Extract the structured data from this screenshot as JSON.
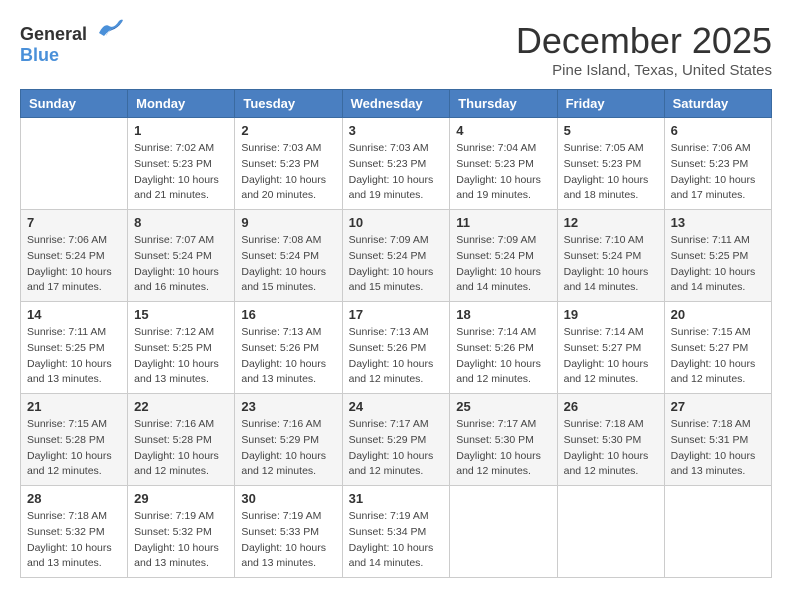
{
  "logo": {
    "text_general": "General",
    "text_blue": "Blue"
  },
  "title": "December 2025",
  "location": "Pine Island, Texas, United States",
  "headers": [
    "Sunday",
    "Monday",
    "Tuesday",
    "Wednesday",
    "Thursday",
    "Friday",
    "Saturday"
  ],
  "weeks": [
    [
      {
        "day": "",
        "info": ""
      },
      {
        "day": "1",
        "info": "Sunrise: 7:02 AM\nSunset: 5:23 PM\nDaylight: 10 hours\nand 21 minutes."
      },
      {
        "day": "2",
        "info": "Sunrise: 7:03 AM\nSunset: 5:23 PM\nDaylight: 10 hours\nand 20 minutes."
      },
      {
        "day": "3",
        "info": "Sunrise: 7:03 AM\nSunset: 5:23 PM\nDaylight: 10 hours\nand 19 minutes."
      },
      {
        "day": "4",
        "info": "Sunrise: 7:04 AM\nSunset: 5:23 PM\nDaylight: 10 hours\nand 19 minutes."
      },
      {
        "day": "5",
        "info": "Sunrise: 7:05 AM\nSunset: 5:23 PM\nDaylight: 10 hours\nand 18 minutes."
      },
      {
        "day": "6",
        "info": "Sunrise: 7:06 AM\nSunset: 5:23 PM\nDaylight: 10 hours\nand 17 minutes."
      }
    ],
    [
      {
        "day": "7",
        "info": "Sunrise: 7:06 AM\nSunset: 5:24 PM\nDaylight: 10 hours\nand 17 minutes."
      },
      {
        "day": "8",
        "info": "Sunrise: 7:07 AM\nSunset: 5:24 PM\nDaylight: 10 hours\nand 16 minutes."
      },
      {
        "day": "9",
        "info": "Sunrise: 7:08 AM\nSunset: 5:24 PM\nDaylight: 10 hours\nand 15 minutes."
      },
      {
        "day": "10",
        "info": "Sunrise: 7:09 AM\nSunset: 5:24 PM\nDaylight: 10 hours\nand 15 minutes."
      },
      {
        "day": "11",
        "info": "Sunrise: 7:09 AM\nSunset: 5:24 PM\nDaylight: 10 hours\nand 14 minutes."
      },
      {
        "day": "12",
        "info": "Sunrise: 7:10 AM\nSunset: 5:24 PM\nDaylight: 10 hours\nand 14 minutes."
      },
      {
        "day": "13",
        "info": "Sunrise: 7:11 AM\nSunset: 5:25 PM\nDaylight: 10 hours\nand 14 minutes."
      }
    ],
    [
      {
        "day": "14",
        "info": "Sunrise: 7:11 AM\nSunset: 5:25 PM\nDaylight: 10 hours\nand 13 minutes."
      },
      {
        "day": "15",
        "info": "Sunrise: 7:12 AM\nSunset: 5:25 PM\nDaylight: 10 hours\nand 13 minutes."
      },
      {
        "day": "16",
        "info": "Sunrise: 7:13 AM\nSunset: 5:26 PM\nDaylight: 10 hours\nand 13 minutes."
      },
      {
        "day": "17",
        "info": "Sunrise: 7:13 AM\nSunset: 5:26 PM\nDaylight: 10 hours\nand 12 minutes."
      },
      {
        "day": "18",
        "info": "Sunrise: 7:14 AM\nSunset: 5:26 PM\nDaylight: 10 hours\nand 12 minutes."
      },
      {
        "day": "19",
        "info": "Sunrise: 7:14 AM\nSunset: 5:27 PM\nDaylight: 10 hours\nand 12 minutes."
      },
      {
        "day": "20",
        "info": "Sunrise: 7:15 AM\nSunset: 5:27 PM\nDaylight: 10 hours\nand 12 minutes."
      }
    ],
    [
      {
        "day": "21",
        "info": "Sunrise: 7:15 AM\nSunset: 5:28 PM\nDaylight: 10 hours\nand 12 minutes."
      },
      {
        "day": "22",
        "info": "Sunrise: 7:16 AM\nSunset: 5:28 PM\nDaylight: 10 hours\nand 12 minutes."
      },
      {
        "day": "23",
        "info": "Sunrise: 7:16 AM\nSunset: 5:29 PM\nDaylight: 10 hours\nand 12 minutes."
      },
      {
        "day": "24",
        "info": "Sunrise: 7:17 AM\nSunset: 5:29 PM\nDaylight: 10 hours\nand 12 minutes."
      },
      {
        "day": "25",
        "info": "Sunrise: 7:17 AM\nSunset: 5:30 PM\nDaylight: 10 hours\nand 12 minutes."
      },
      {
        "day": "26",
        "info": "Sunrise: 7:18 AM\nSunset: 5:30 PM\nDaylight: 10 hours\nand 12 minutes."
      },
      {
        "day": "27",
        "info": "Sunrise: 7:18 AM\nSunset: 5:31 PM\nDaylight: 10 hours\nand 13 minutes."
      }
    ],
    [
      {
        "day": "28",
        "info": "Sunrise: 7:18 AM\nSunset: 5:32 PM\nDaylight: 10 hours\nand 13 minutes."
      },
      {
        "day": "29",
        "info": "Sunrise: 7:19 AM\nSunset: 5:32 PM\nDaylight: 10 hours\nand 13 minutes."
      },
      {
        "day": "30",
        "info": "Sunrise: 7:19 AM\nSunset: 5:33 PM\nDaylight: 10 hours\nand 13 minutes."
      },
      {
        "day": "31",
        "info": "Sunrise: 7:19 AM\nSunset: 5:34 PM\nDaylight: 10 hours\nand 14 minutes."
      },
      {
        "day": "",
        "info": ""
      },
      {
        "day": "",
        "info": ""
      },
      {
        "day": "",
        "info": ""
      }
    ]
  ]
}
